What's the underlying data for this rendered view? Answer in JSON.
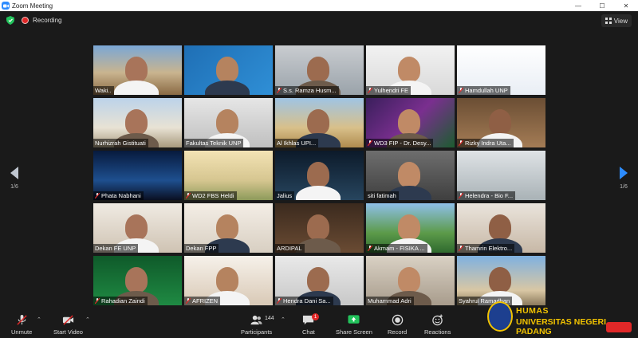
{
  "window": {
    "title": "Zoom Meeting",
    "minimize": "—",
    "maximize": "☐",
    "close": "✕"
  },
  "topbar": {
    "recording_label": "Recording",
    "view_label": "View"
  },
  "pager": {
    "left": "1/6",
    "right": "1/6"
  },
  "participants": [
    {
      "name": "Waki..",
      "muted": false
    },
    {
      "name": "",
      "muted": false
    },
    {
      "name": "S.s. Ramza Husm...",
      "muted": true
    },
    {
      "name": "Yulhendri FE",
      "muted": true
    },
    {
      "name": "Hamdullah UNP",
      "muted": true
    },
    {
      "name": "Nurhizrah Gistituati",
      "muted": false
    },
    {
      "name": "Fakultas Teknik UNP",
      "muted": false
    },
    {
      "name": "Al Ikhlas UPI...",
      "muted": false
    },
    {
      "name": "WD3 FIP - Dr. Desy...",
      "muted": true
    },
    {
      "name": "Rizky Indra Uta...",
      "muted": true
    },
    {
      "name": "Phata Nabhani",
      "muted": true
    },
    {
      "name": "WD2 FBS Heldi",
      "muted": true
    },
    {
      "name": "Jalius",
      "muted": false
    },
    {
      "name": "siti fatimah",
      "muted": false
    },
    {
      "name": "Helendra - Bio F...",
      "muted": true
    },
    {
      "name": "Dekan FE UNP",
      "muted": false
    },
    {
      "name": "Dekan FPP",
      "muted": false
    },
    {
      "name": "ARDIPAL",
      "muted": false
    },
    {
      "name": "Akmam - FISIKA ...",
      "muted": true
    },
    {
      "name": "Thamrin Elektro...",
      "muted": true
    },
    {
      "name": "Rahadian Zaindi",
      "muted": true
    },
    {
      "name": "AFRIZEN",
      "muted": true
    },
    {
      "name": "Hendra Dani Sa...",
      "muted": true
    },
    {
      "name": "Muhammad Adri",
      "muted": false
    },
    {
      "name": "Syahrul Ramadhan",
      "muted": false
    }
  ],
  "toolbar": {
    "unmute": "Unmute",
    "start_video": "Start Video",
    "participants": "Participants",
    "participants_count": "144",
    "chat": "Chat",
    "chat_badge": "1",
    "share_screen": "Share Screen",
    "record": "Record",
    "reactions": "Reactions"
  },
  "overlay": {
    "line1": "HUMAS",
    "line2": "UNIVERSITAS NEGERI PADANG"
  },
  "icons": [
    "zoom-icon",
    "shield-icon",
    "recording-icon",
    "view-icon",
    "mic-off-icon",
    "video-off-icon",
    "participants-icon",
    "chat-icon",
    "share-screen-icon",
    "record-icon",
    "reactions-icon"
  ],
  "colors": {
    "accent": "#2d8cff",
    "share": "#23c35c",
    "recording": "#e02828",
    "humas": "#f2c300"
  }
}
